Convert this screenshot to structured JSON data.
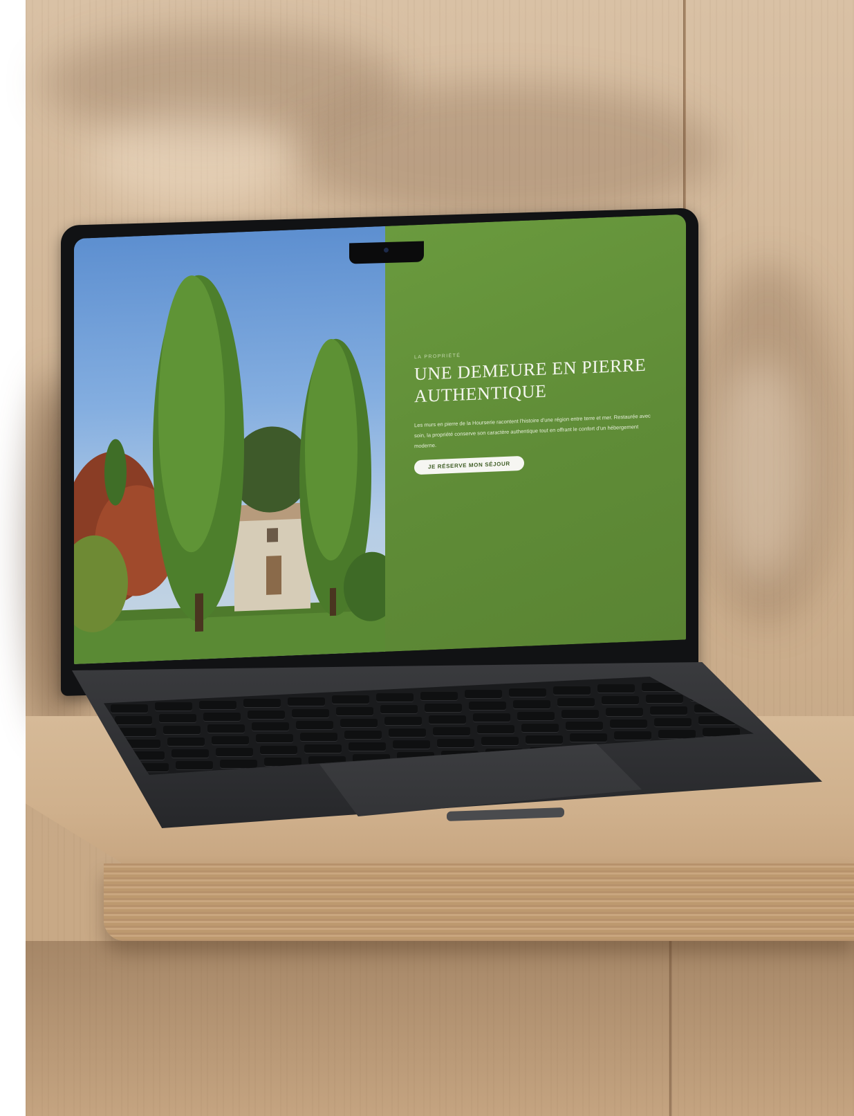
{
  "website": {
    "eyebrow": "LA PROPRIÉTÉ",
    "headline": "UNE DEMEURE EN PIERRE AUTHENTIQUE",
    "body": "Les murs en pierre de la Hourserie racontent l'histoire d'une région entre terre et mer. Restaurée avec soin, la propriété conserve son caractère authentique tout en offrant le confort d'un hébergement moderne.",
    "cta_label": "JE RÉSERVE MON SÉJOUR",
    "accent_green": "#5f8c37"
  }
}
